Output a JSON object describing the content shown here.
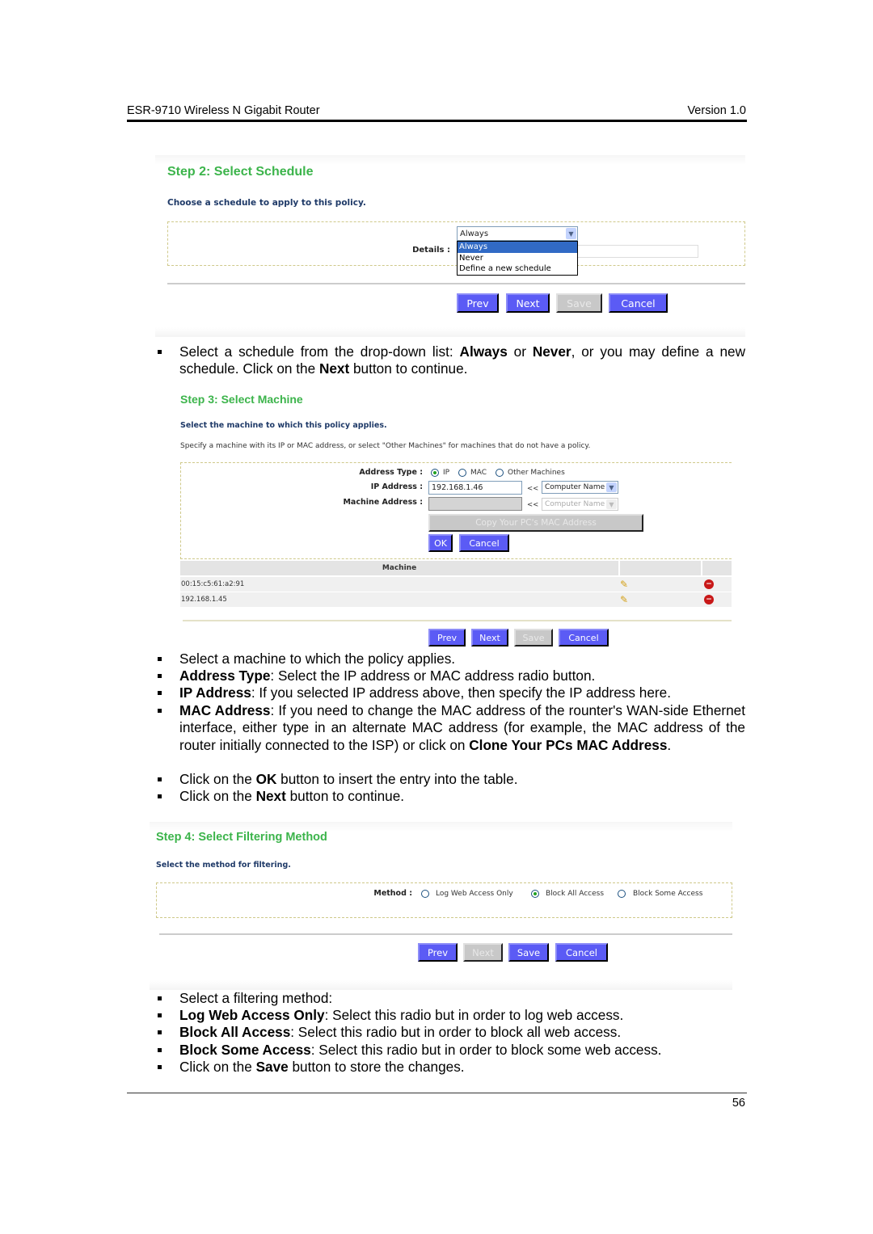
{
  "header": {
    "title": "ESR-9710 Wireless N Gigabit Router",
    "version": "Version 1.0"
  },
  "footer": {
    "page_number": "56"
  },
  "step2": {
    "title": "Step 2: Select Schedule",
    "subtitle": "Choose a schedule to apply to this policy.",
    "details_label": "Details :",
    "schedule_select": {
      "selected": "Always",
      "options": [
        "Always",
        "Never",
        "Define a new schedule"
      ],
      "highlighted": "Always"
    },
    "buttons": {
      "prev": "Prev",
      "next": "Next",
      "save": "Save",
      "cancel": "Cancel"
    }
  },
  "bullets_step2": {
    "p1_a": "Select a schedule from the drop-down list: ",
    "p1_always": "Always",
    "p1_or": " or ",
    "p1_never": "Never",
    "p1_b": ", or you may define a new schedule. Click on the ",
    "p1_next": "Next",
    "p1_c": " button to continue."
  },
  "step3": {
    "title": "Step 3: Select Machine",
    "subtitle": "Select the machine to which this policy applies.",
    "description": "Specify a machine with its IP or MAC address, or select \"Other Machines\" for machines that do not have a policy.",
    "address_type_label": "Address Type :",
    "address_types": [
      "IP",
      "MAC",
      "Other Machines"
    ],
    "address_type_selected": "IP",
    "ip_label": "IP Address :",
    "ip_value": "192.168.1.46",
    "machine_label": "Machine Address :",
    "machine_value": "",
    "arrow": "<<",
    "computer_name_select": "Computer Name",
    "copy_mac_button": "Copy Your PC's MAC Address",
    "ok_button": "OK",
    "cancel_button": "Cancel",
    "table": {
      "header": "Machine",
      "rows": [
        "00:15:c5:61:a2:91",
        "192.168.1.45"
      ]
    },
    "buttons": {
      "prev": "Prev",
      "next": "Next",
      "save": "Save",
      "cancel": "Cancel"
    }
  },
  "bullets_step3": [
    {
      "bold": "",
      "text": "Select a machine to which the policy applies."
    },
    {
      "bold": "Address Type",
      "text": ": Select the IP address or MAC address radio button."
    },
    {
      "bold": "IP Address",
      "text": ": If you selected IP address above, then specify the IP address here."
    },
    {
      "bold": "MAC Address",
      "text": ": If you need to change the MAC address of the rounter's WAN-side Ethernet interface, either type in an alternate MAC address (for example, the MAC address of the router initially connected to the ISP) or click on ",
      "bold2": "Clone Your PCs MAC Address",
      "tail": "."
    },
    {
      "pre": "Click on the ",
      "bold": "OK",
      "text": " button to insert the entry into the table."
    },
    {
      "pre": "Click on the ",
      "bold": "Next",
      "text": " button to continue."
    }
  ],
  "step4": {
    "title": "Step 4: Select Filtering Method",
    "subtitle": "Select the method for filtering.",
    "method_label": "Method :",
    "methods": [
      "Log Web Access Only",
      "Block All Access",
      "Block Some Access"
    ],
    "method_selected": "Block All Access",
    "buttons": {
      "prev": "Prev",
      "next": "Next",
      "save": "Save",
      "cancel": "Cancel"
    }
  },
  "bullets_step4": [
    {
      "bold": "",
      "text": "Select a filtering method:"
    },
    {
      "bold": "Log Web Access Only",
      "text": ": Select this radio but in order to log web access."
    },
    {
      "bold": "Block All Access",
      "text": ": Select this radio but in order to block all web access."
    },
    {
      "bold": "Block Some Access",
      "text": ": Select this radio but in order to block some web access."
    },
    {
      "pre": "Click on the ",
      "bold": "Save",
      "text": " button to store the changes."
    }
  ]
}
